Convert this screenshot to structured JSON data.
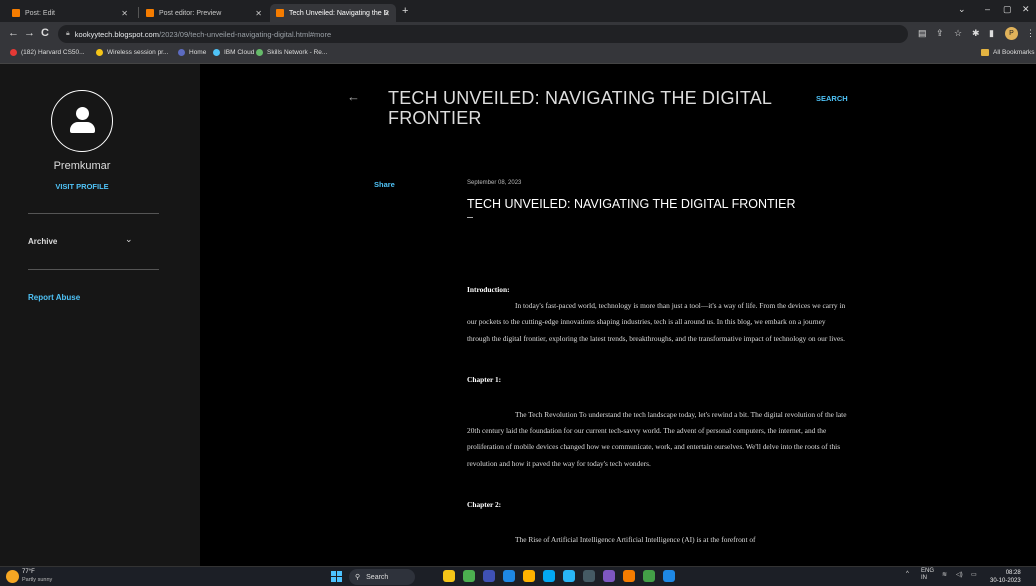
{
  "browser": {
    "tabs": [
      {
        "title": "Post: Edit",
        "favicon_color": "#f57c00",
        "active": false
      },
      {
        "title": "Post editor: Preview",
        "favicon_color": "#f57c00",
        "active": false
      },
      {
        "title": "Tech Unveiled: Navigating the D",
        "favicon_color": "#f57c00",
        "active": true
      }
    ],
    "new_tab": "+",
    "window_controls": {
      "minimize": "–",
      "maximize": "▢",
      "close": "✕",
      "dropdown": "⌄"
    },
    "nav": {
      "back": "←",
      "forward": "→",
      "reload": "C"
    },
    "address": {
      "host": "kookyytech.blogspot.com",
      "path": "/2023/09/tech-unveiled-navigating-digital.html#more"
    },
    "profile_initial": "P",
    "bookmarks": [
      {
        "label": "(182) Harvard CS50...",
        "color": "#e53935"
      },
      {
        "label": "Wireless session pr...",
        "color": "#f5c518"
      },
      {
        "label": "Home",
        "color": "#5c6bc0"
      },
      {
        "label": "IBM Cloud",
        "color": "#4fc3f7"
      },
      {
        "label": "Skills Network - Re...",
        "color": "#66bb6a"
      }
    ],
    "all_bookmarks": "All Bookmarks"
  },
  "sidebar": {
    "profile_name": "Premkumar",
    "visit_profile": "VISIT PROFILE",
    "archive": "Archive",
    "archive_chevron": "⌄",
    "report_abuse": "Report Abuse"
  },
  "header": {
    "back": "←",
    "blog_title": "TECH UNVEILED: NAVIGATING THE DIGITAL FRONTIER",
    "search": "SEARCH"
  },
  "post": {
    "share": "Share",
    "date": "September 08, 2023",
    "title": "TECH UNVEILED: NAVIGATING THE DIGITAL FRONTIER",
    "intro_heading": "Introduction:",
    "intro_text": "In today's fast-paced world, technology is more than just a tool—it's a way of life. From the devices we carry in our pockets to the cutting-edge innovations shaping industries, tech is all around us. In this blog, we embark on a journey through the digital frontier, exploring the latest trends, breakthroughs, and the transformative impact of technology on our lives.",
    "ch1_heading": "Chapter 1:",
    "ch1_text": "The Tech Revolution To understand the tech landscape today, let's rewind a bit. The digital revolution of the late 20th century laid the foundation for our current tech-savvy world. The advent of personal computers, the internet, and the proliferation of mobile devices changed how we communicate, work, and entertain ourselves. We'll delve into the roots of this revolution and how it paved the way for today's tech wonders.",
    "ch2_heading": "Chapter 2:",
    "ch2_text": "The Rise of Artificial Intelligence Artificial Intelligence (AI) is at the forefront of"
  },
  "taskbar": {
    "temperature": "77°F",
    "weather": "Partly sunny",
    "search": "Search",
    "app_colors": [
      "#f5c518",
      "#4caf50",
      "#3f51b5",
      "#1e88e5",
      "#ffb300",
      "#03a9f4",
      "#29b6f6",
      "#455a64",
      "#7e57c2",
      "#f57c00",
      "#43a047",
      "#1e88e5"
    ],
    "tray_lang": "ENG",
    "tray_region": "IN",
    "time": "08:28",
    "date": "30-10-2023"
  }
}
